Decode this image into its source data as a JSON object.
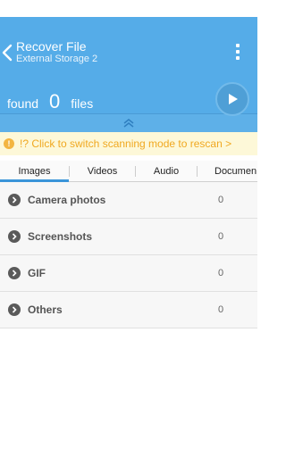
{
  "header": {
    "title": "Recover File",
    "subtitle": "External Storage 2",
    "found_label": "found",
    "found_count": "0",
    "files_label": "files",
    "accent_color": "#55ace8"
  },
  "notice": {
    "text": "!? Click to switch scanning mode to rescan >"
  },
  "tabs": [
    {
      "label": "Images",
      "active": true
    },
    {
      "label": "Videos",
      "active": false
    },
    {
      "label": "Audio",
      "active": false
    },
    {
      "label": "Documen",
      "active": false
    }
  ],
  "categories": [
    {
      "label": "Camera photos",
      "count": "0"
    },
    {
      "label": "Screenshots",
      "count": "0"
    },
    {
      "label": "GIF",
      "count": "0"
    },
    {
      "label": "Others",
      "count": "0"
    }
  ],
  "icons": {
    "back": "chevron-left-icon",
    "menu": "overflow-menu-icon",
    "play": "play-icon",
    "collapse": "double-chevron-up-icon",
    "warning": "warning-icon",
    "row": "chevron-right-circle-icon"
  }
}
